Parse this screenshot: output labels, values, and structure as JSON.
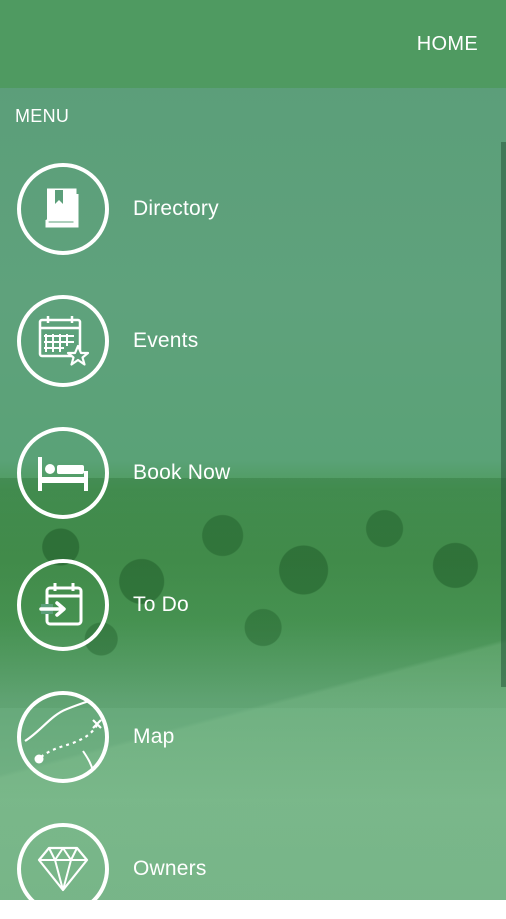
{
  "header": {
    "home_label": "HOME"
  },
  "menu": {
    "title": "MENU",
    "items": [
      {
        "label": "Directory",
        "icon": "book-icon"
      },
      {
        "label": "Events",
        "icon": "calendar-star-icon"
      },
      {
        "label": "Book Now",
        "icon": "bed-icon"
      },
      {
        "label": "To Do",
        "icon": "calendar-enter-icon"
      },
      {
        "label": "Map",
        "icon": "map-route-icon"
      },
      {
        "label": "Owners",
        "icon": "diamond-icon"
      }
    ]
  },
  "colors": {
    "topbar": "#4f9a61",
    "overlay": "#5c9f7a",
    "text": "#ffffff"
  }
}
